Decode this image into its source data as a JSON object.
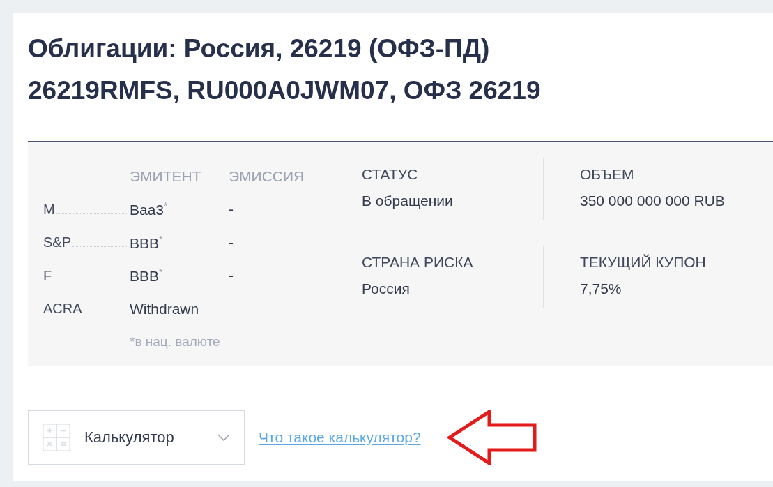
{
  "title_lines": [
    "Облигации: Россия, 26219 (ОФЗ-ПД)",
    "26219RMFS, RU000A0JWM07, ОФЗ 26219"
  ],
  "ratings": {
    "columns": [
      "ЭМИТЕНТ",
      "ЭМИССИЯ"
    ],
    "rows": [
      {
        "agency": "M",
        "issuer": "Baa3$^{*}$",
        "emission": "-"
      },
      {
        "agency": "S&P",
        "issuer": "BBB$^{*}$",
        "emission": "-"
      },
      {
        "agency": "F",
        "issuer": "BBB$^{*}$",
        "emission": "-"
      },
      {
        "agency": "ACRA",
        "issuer": "Withdrawn"
      }
    ],
    "footnote": "*в нац. валюте"
  },
  "facts": [
    [
      {
        "label": "СТАТУС",
        "value": "В обращении"
      },
      {
        "label": "ОБЪЕМ",
        "value": "350 000 000 000 RUB"
      }
    ],
    [
      {
        "label": "СТРАНА РИСКА",
        "value": "Россия"
      },
      {
        "label": "ТЕКУЩИЙ КУПОН",
        "value": "7,75%"
      }
    ]
  ],
  "calculator": {
    "label": "Калькулятор",
    "expanded": false
  },
  "help_link": "Что такое калькулятор?"
}
